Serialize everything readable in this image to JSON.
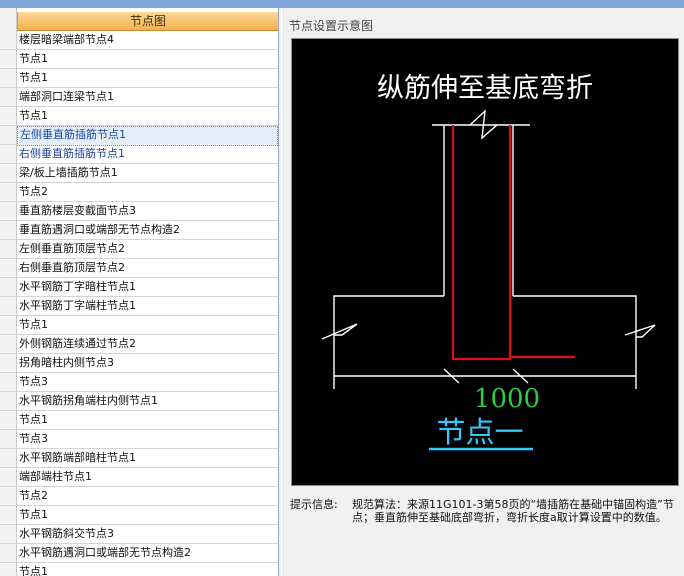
{
  "left_panel": {
    "column_header": "节点图",
    "rows": [
      {
        "label": "楼层暗梁端部节点4"
      },
      {
        "label": "节点1"
      },
      {
        "label": "节点1"
      },
      {
        "label": "端部洞口连梁节点1"
      },
      {
        "label": "节点1"
      },
      {
        "label": "左侧垂直筋插筋节点1"
      },
      {
        "label": "右侧垂直筋插筋节点1"
      },
      {
        "label": "梁/板上墙插筋节点1"
      },
      {
        "label": "节点2"
      },
      {
        "label": "垂直筋楼层变截面节点3"
      },
      {
        "label": "垂直筋遇洞口或端部无节点构造2"
      },
      {
        "label": "左侧垂直筋顶层节点2"
      },
      {
        "label": "右侧垂直筋顶层节点2"
      },
      {
        "label": "水平钢筋丁字暗柱节点1"
      },
      {
        "label": "水平钢筋丁字端柱节点1"
      },
      {
        "label": "节点1"
      },
      {
        "label": "外侧钢筋连续通过节点2"
      },
      {
        "label": "拐角暗柱内侧节点3"
      },
      {
        "label": "节点3"
      },
      {
        "label": "水平钢筋拐角端柱内侧节点1"
      },
      {
        "label": "节点1"
      },
      {
        "label": "节点3"
      },
      {
        "label": "水平钢筋端部暗柱节点1"
      },
      {
        "label": "端部端柱节点1"
      },
      {
        "label": "节点2"
      },
      {
        "label": "节点1"
      },
      {
        "label": "水平钢筋斜交节点3"
      },
      {
        "label": "水平钢筋遇洞口或端部无节点构造2"
      },
      {
        "label": "节点1"
      }
    ],
    "selected_index": 5
  },
  "right_panel": {
    "title": "节点设置示意图",
    "diagram": {
      "heading": "纵筋伸至基底弯折",
      "dimension": "1000",
      "node_label": "节点一",
      "colors": {
        "background": "#000000",
        "outline": "#ffffff",
        "rebar": "#e01010",
        "dimension": "#2ecc40",
        "node_label": "#33c8ff"
      }
    },
    "tip_label": "提示信息:",
    "tip_text": "规范算法：来源11G101-3第58页的“墙插筋在基础中锚固构造”节点；垂直筋伸至基础底部弯折，弯折长度a取计算设置中的数值。"
  }
}
